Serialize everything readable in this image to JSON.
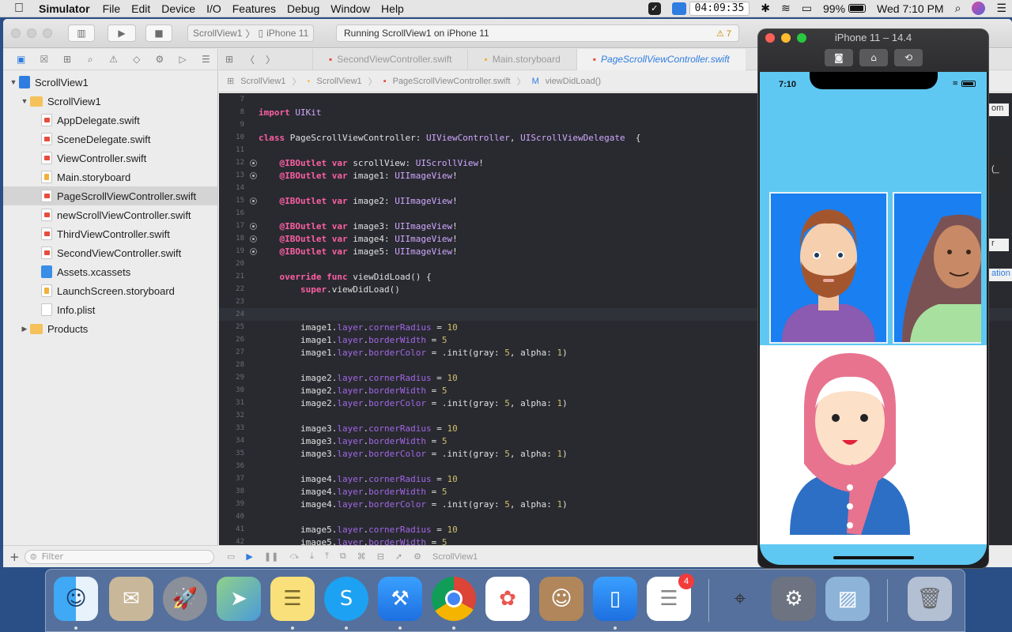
{
  "menubar": {
    "app_name": "Simulator",
    "menus": [
      "File",
      "Edit",
      "Device",
      "I/O",
      "Features",
      "Debug",
      "Window",
      "Help"
    ],
    "clock_time": "04:09:35",
    "battery": "99%",
    "datetime": "Wed 7:10 PM"
  },
  "toolbar": {
    "scheme_project": "ScrollView1",
    "scheme_device": "iPhone 11",
    "activity_status": "Running ScrollView1 on iPhone 11",
    "warning_count": "7"
  },
  "navigator": {
    "items": [
      {
        "label": "ScrollView1",
        "type": "proj",
        "level": 0,
        "open": true
      },
      {
        "label": "ScrollView1",
        "type": "folder",
        "level": 1,
        "open": true
      },
      {
        "label": "AppDelegate.swift",
        "type": "swift",
        "level": 2
      },
      {
        "label": "SceneDelegate.swift",
        "type": "swift",
        "level": 2
      },
      {
        "label": "ViewController.swift",
        "type": "swift",
        "level": 2
      },
      {
        "label": "Main.storyboard",
        "type": "sb",
        "level": 2
      },
      {
        "label": "PageScrollViewController.swift",
        "type": "swift",
        "level": 2,
        "selected": true
      },
      {
        "label": "newScrollViewController.swift",
        "type": "swift",
        "level": 2
      },
      {
        "label": "ThirdViewController.swift",
        "type": "swift",
        "level": 2
      },
      {
        "label": "SecondViewController.swift",
        "type": "swift",
        "level": 2
      },
      {
        "label": "Assets.xcassets",
        "type": "assets",
        "level": 2
      },
      {
        "label": "LaunchScreen.storyboard",
        "type": "sb",
        "level": 2
      },
      {
        "label": "Info.plist",
        "type": "plist",
        "level": 2
      },
      {
        "label": "Products",
        "type": "folder",
        "level": 1,
        "open": false
      }
    ],
    "filter_placeholder": "Filter"
  },
  "editor": {
    "tabs": [
      {
        "label": "SecondViewController.swift",
        "active": false
      },
      {
        "label": "Main.storyboard",
        "active": false
      },
      {
        "label": "PageScrollViewController.swift",
        "active": true
      }
    ],
    "jumpbar": [
      "ScrollView1",
      "ScrollView1",
      "PageScrollViewController.swift",
      "viewDidLoad()"
    ],
    "bottom_scheme": "ScrollView1",
    "code_lines": [
      {
        "n": "7",
        "t": ""
      },
      {
        "n": "8",
        "t": "import UIKit"
      },
      {
        "n": "9",
        "t": ""
      },
      {
        "n": "10",
        "t": "class PageScrollViewController: UIViewController, UIScrollViewDelegate  {"
      },
      {
        "n": "11",
        "t": ""
      },
      {
        "n": "12",
        "t": "    @IBOutlet var scrollView: UIScrollView!",
        "outlet": true
      },
      {
        "n": "13",
        "t": "    @IBOutlet var image1: UIImageView!",
        "outlet": true
      },
      {
        "n": "14",
        "t": ""
      },
      {
        "n": "15",
        "t": "    @IBOutlet var image2: UIImageView!",
        "outlet": true
      },
      {
        "n": "16",
        "t": ""
      },
      {
        "n": "17",
        "t": "    @IBOutlet var image3: UIImageView!",
        "outlet": true
      },
      {
        "n": "18",
        "t": "    @IBOutlet var image4: UIImageView!",
        "outlet": true
      },
      {
        "n": "19",
        "t": "    @IBOutlet var image5: UIImageView!",
        "outlet": true
      },
      {
        "n": "20",
        "t": ""
      },
      {
        "n": "21",
        "t": "    override func viewDidLoad() {"
      },
      {
        "n": "22",
        "t": "        super.viewDidLoad()"
      },
      {
        "n": "23",
        "t": ""
      },
      {
        "n": "24",
        "t": "",
        "current": true
      },
      {
        "n": "25",
        "t": "        image1.layer.cornerRadius = 10"
      },
      {
        "n": "26",
        "t": "        image1.layer.borderWidth = 5"
      },
      {
        "n": "27",
        "t": "        image1.layer.borderColor = .init(gray: 5, alpha: 1)"
      },
      {
        "n": "28",
        "t": ""
      },
      {
        "n": "29",
        "t": "        image2.layer.cornerRadius = 10"
      },
      {
        "n": "30",
        "t": "        image2.layer.borderWidth = 5"
      },
      {
        "n": "31",
        "t": "        image2.layer.borderColor = .init(gray: 5, alpha: 1)"
      },
      {
        "n": "32",
        "t": ""
      },
      {
        "n": "33",
        "t": "        image3.layer.cornerRadius = 10"
      },
      {
        "n": "34",
        "t": "        image3.layer.borderWidth = 5"
      },
      {
        "n": "35",
        "t": "        image3.layer.borderColor = .init(gray: 5, alpha: 1)"
      },
      {
        "n": "36",
        "t": ""
      },
      {
        "n": "37",
        "t": "        image4.layer.cornerRadius = 10"
      },
      {
        "n": "38",
        "t": "        image4.layer.borderWidth = 5"
      },
      {
        "n": "39",
        "t": "        image4.layer.borderColor = .init(gray: 5, alpha: 1)"
      },
      {
        "n": "40",
        "t": ""
      },
      {
        "n": "41",
        "t": "        image5.layer.cornerRadius = 10"
      },
      {
        "n": "42",
        "t": "        image5.layer.borderWidth = 5"
      }
    ]
  },
  "simulator": {
    "title": "iPhone 11 – 14.4",
    "status_time": "7:10"
  },
  "peek": {
    "text1": "om",
    "text2": "(_",
    "text3": "r",
    "text4": "ation"
  },
  "dock": {
    "items": [
      {
        "name": "finder",
        "running": true
      },
      {
        "name": "mail",
        "running": false
      },
      {
        "name": "launchpad",
        "running": false
      },
      {
        "name": "maps",
        "running": false
      },
      {
        "name": "notes",
        "running": true
      },
      {
        "name": "skype",
        "running": true
      },
      {
        "name": "xcode",
        "running": true
      },
      {
        "name": "chrome",
        "running": true
      },
      {
        "name": "photos",
        "running": false
      },
      {
        "name": "contacts",
        "running": false
      },
      {
        "name": "simulator",
        "running": true
      },
      {
        "name": "reminders",
        "running": false,
        "badge": "4"
      },
      {
        "name": "system-information",
        "running": false
      },
      {
        "name": "system-preferences",
        "running": false
      },
      {
        "name": "preview",
        "running": false
      },
      {
        "name": "trash",
        "running": false
      }
    ]
  },
  "colors": {
    "accent": "#2f7de1",
    "code_bg": "#292a30",
    "keyword": "#fc5fa3",
    "number": "#d0bf69",
    "sim_bg": "#5ec8f2"
  }
}
